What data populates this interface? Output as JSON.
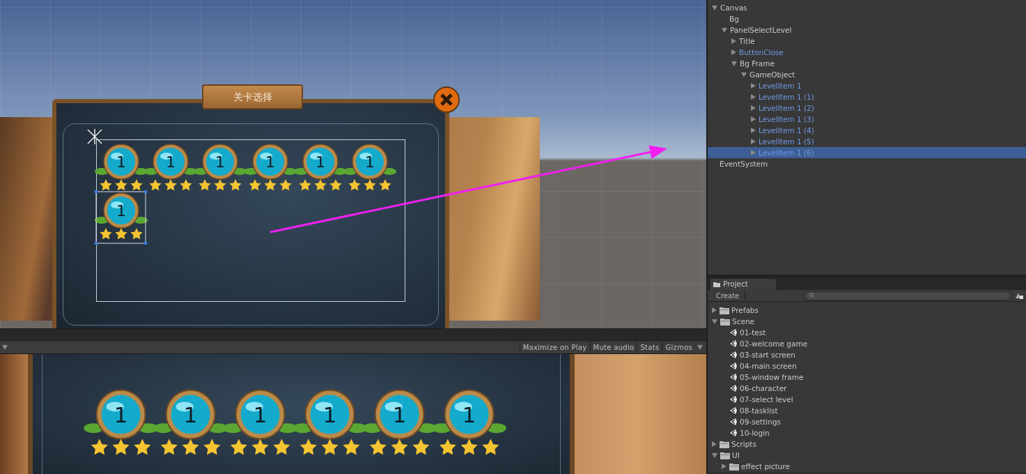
{
  "scene_view": {
    "title_plank": "关卡选择",
    "level_items": [
      {
        "label": "1",
        "stars": 3,
        "selected": false
      },
      {
        "label": "1",
        "stars": 3,
        "selected": false
      },
      {
        "label": "1",
        "stars": 3,
        "selected": false
      },
      {
        "label": "1",
        "stars": 3,
        "selected": false
      },
      {
        "label": "1",
        "stars": 3,
        "selected": false
      },
      {
        "label": "1",
        "stars": 3,
        "selected": false
      },
      {
        "label": "1",
        "stars": 3,
        "selected": true
      }
    ]
  },
  "game_view": {
    "toolbar": [
      "Maximize on Play",
      "Mute audio",
      "Stats",
      "Gizmos"
    ],
    "level_items": [
      {
        "label": "1",
        "stars": 3
      },
      {
        "label": "1",
        "stars": 3
      },
      {
        "label": "1",
        "stars": 3
      },
      {
        "label": "1",
        "stars": 3
      },
      {
        "label": "1",
        "stars": 3
      },
      {
        "label": "1",
        "stars": 3
      }
    ]
  },
  "hierarchy": [
    {
      "name": "Canvas",
      "expanded": true,
      "prefab": false,
      "selected": false,
      "children": [
        {
          "name": "Bg",
          "prefab": false,
          "selected": false
        },
        {
          "name": "PanelSelectLevel",
          "expanded": true,
          "prefab": false,
          "selected": false,
          "children": [
            {
              "name": "Title",
              "expanded": false,
              "prefab": false,
              "selected": false
            },
            {
              "name": "ButtonClose",
              "expanded": false,
              "prefab": true,
              "selected": false
            },
            {
              "name": "Bg Frame",
              "expanded": true,
              "prefab": false,
              "selected": false,
              "children": [
                {
                  "name": "GameObject",
                  "expanded": true,
                  "prefab": false,
                  "selected": false,
                  "children": [
                    {
                      "name": "LevelItem 1",
                      "expanded": false,
                      "prefab": true,
                      "selected": false
                    },
                    {
                      "name": "LevelItem 1 (1)",
                      "expanded": false,
                      "prefab": true,
                      "selected": false
                    },
                    {
                      "name": "LevelItem 1 (2)",
                      "expanded": false,
                      "prefab": true,
                      "selected": false
                    },
                    {
                      "name": "LevelItem 1 (3)",
                      "expanded": false,
                      "prefab": true,
                      "selected": false
                    },
                    {
                      "name": "LevelItem 1 (4)",
                      "expanded": false,
                      "prefab": true,
                      "selected": false
                    },
                    {
                      "name": "LevelItem 1 (5)",
                      "expanded": false,
                      "prefab": true,
                      "selected": false
                    },
                    {
                      "name": "LevelItem 1 (6)",
                      "expanded": false,
                      "prefab": true,
                      "selected": true
                    }
                  ]
                }
              ]
            }
          ]
        }
      ]
    },
    {
      "name": "EventSystem",
      "prefab": false,
      "selected": false
    }
  ],
  "project": {
    "tab": "Project",
    "create_button": "Create",
    "items": [
      {
        "name": "Prefabs",
        "kind": "folder",
        "expanded": false
      },
      {
        "name": "Scene",
        "kind": "folder",
        "expanded": true,
        "children": [
          {
            "name": "01-test",
            "kind": "scene"
          },
          {
            "name": "02-welcome game",
            "kind": "scene"
          },
          {
            "name": "03-start screen",
            "kind": "scene"
          },
          {
            "name": "04-main screen",
            "kind": "scene"
          },
          {
            "name": "05-window frame",
            "kind": "scene"
          },
          {
            "name": "06-character",
            "kind": "scene"
          },
          {
            "name": "07-select level",
            "kind": "scene"
          },
          {
            "name": "08-tasklist",
            "kind": "scene"
          },
          {
            "name": "09-settings",
            "kind": "scene"
          },
          {
            "name": "10-login",
            "kind": "scene"
          }
        ]
      },
      {
        "name": "Scripts",
        "kind": "folder",
        "expanded": false
      },
      {
        "name": "UI",
        "kind": "folder",
        "expanded": true,
        "children": [
          {
            "name": "effect picture",
            "kind": "folder",
            "expanded": false
          }
        ]
      }
    ]
  }
}
